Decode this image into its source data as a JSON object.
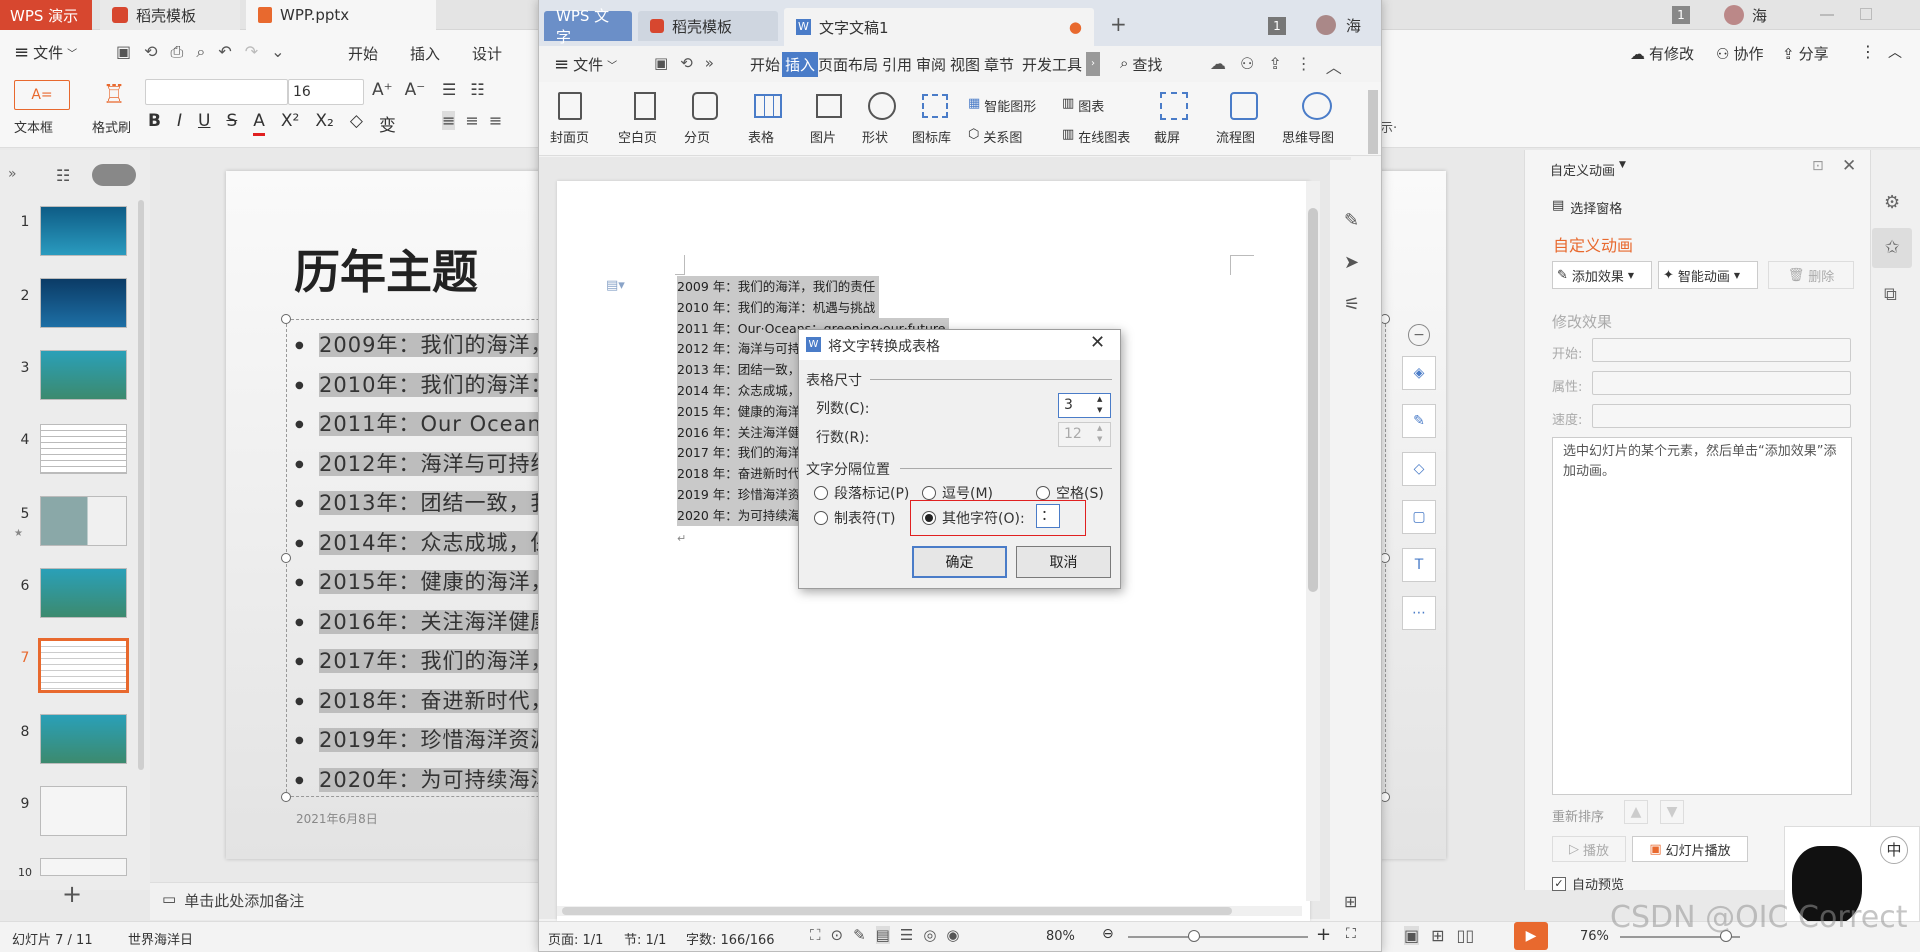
{
  "tabs": {
    "app": "WPS 演示",
    "template": "稻壳模板",
    "file": "WPP.pptx"
  },
  "menu": {
    "file": "文件",
    "start": "开始",
    "insert": "插入",
    "design": "设计",
    "has_changes": "有修改",
    "collab": "协作",
    "share": "分享"
  },
  "ribbon": {
    "textbox": "文本框",
    "format_painter": "格式刷",
    "font_size": "16",
    "change": "变"
  },
  "thumbnails": [
    "1",
    "2",
    "3",
    "4",
    "5",
    "6",
    "7",
    "8",
    "9",
    "10"
  ],
  "slide": {
    "title": "历年主题",
    "date": "2021年6月8日",
    "notes": "单击此处添加备注",
    "bullets": [
      "2009年：我们的海洋，",
      "2010年：我们的海洋：",
      "2011年：Our Oceans",
      "2012年：海洋与可持续",
      "2013年：团结一致，我",
      "2014年：众志成城，保",
      "2015年：健康的海洋，",
      "2016年：关注海洋健康",
      "2017年：我们的海洋，",
      "2018年：奋进新时代，",
      "2019年：珍惜海洋资源",
      "2020年：为可持续海洋"
    ]
  },
  "writer": {
    "tab_app": "WPS 文字",
    "tab_template": "稻壳模板",
    "tab_doc": "文字文稿1",
    "badge": "1",
    "user": "海",
    "menu": [
      "文件",
      "开始",
      "插入",
      "页面布局",
      "引用",
      "审阅",
      "视图",
      "章节",
      "开发工具"
    ],
    "search": "查找",
    "ribbon": [
      "封面页",
      "空白页",
      "分页",
      "表格",
      "图片",
      "形状",
      "图标库",
      "智能图形",
      "关系图",
      "图表",
      "在线图表",
      "截屏",
      "流程图",
      "思维导图"
    ],
    "lines": [
      "2009 年：我们的海洋，我们的责任",
      "2010 年：我们的海洋：机遇与挑战",
      "2011 年：Our·Oceans：greening·our·future",
      "2012 年：海洋与可持续",
      "2013 年：团结一致，",
      "2014 年：众志成城，",
      "2015 年：健康的海洋",
      "2016 年：关注海洋健",
      "2017 年：我们的海洋",
      "2018 年：奋进新时代",
      "2019 年：珍惜海洋资",
      "2020 年：为可持续海"
    ],
    "status": {
      "page": "页面: 1/1",
      "section": "节: 1/1",
      "words": "字数: 166/166",
      "zoom": "80%"
    }
  },
  "dialog": {
    "title": "将文字转换成表格",
    "group_size": "表格尺寸",
    "cols_label": "列数(C):",
    "cols": "3",
    "rows_label": "行数(R):",
    "rows": "12",
    "group_sep": "文字分隔位置",
    "para": "段落标记(P)",
    "comma": "逗号(M)",
    "space": "空格(S)",
    "tab": "制表符(T)",
    "other": "其他字符(O):",
    "other_char": "：",
    "ok": "确定",
    "cancel": "取消"
  },
  "anim": {
    "header": "自定义动画",
    "select_pane": "选择窗格",
    "title": "自定义动画",
    "add": "添加效果",
    "smart": "智能动画",
    "delete": "删除",
    "modify": "修改效果",
    "start": "开始:",
    "prop": "属性:",
    "speed": "速度:",
    "hint": "选中幻灯片的某个元素，然后单击“添加效果”添加动画。",
    "reorder": "重新排序",
    "play": "播放",
    "slideshow": "幻灯片播放",
    "auto_preview": "自动预览"
  },
  "status": {
    "slide": "幻灯片 7 / 11",
    "theme": "世界海洋日",
    "zoom": "76%"
  },
  "watermark": "CSDN @OIC Correct",
  "ime": "中",
  "colors": {
    "accent": "#e8692e",
    "wps_red": "#d7472f",
    "dialog_highlight": "#e02020"
  }
}
